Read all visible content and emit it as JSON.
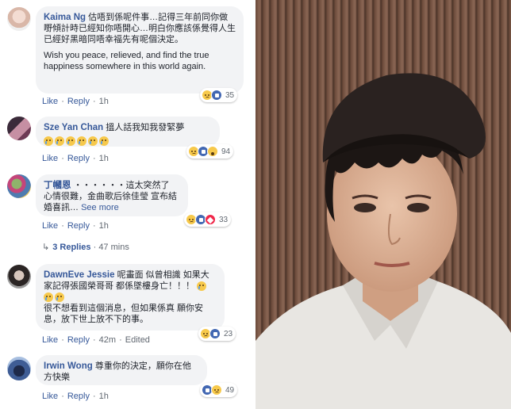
{
  "comments": [
    {
      "author": "Kaima Ng",
      "text": "估唔到係呢件事…記得三年前同你做嘢傾計時已經知你唔開心…明白你應該係覺得人生已經好黑暗同唔幸福先有呢個決定。",
      "text_en": "Wish you peace, relieved, and find the true happiness somewhere in this world again.",
      "reaction_count": "35",
      "like": "Like",
      "reply": "Reply",
      "time": "1h"
    },
    {
      "author": "Sze Yan Chan",
      "text": "搵人話我知我發緊夢",
      "reaction_count": "94",
      "like": "Like",
      "reply": "Reply",
      "time": "1h"
    },
    {
      "author": "丁幗恩",
      "text": "・・・・・・這太突然了 心情很難，金曲歌后徐佳瑩 宣布結婚喜訊…",
      "see_more": "See more",
      "reaction_count": "33",
      "like": "Like",
      "reply": "Reply",
      "time": "1h",
      "replies_label": "3 Replies",
      "replies_time": "47 mins"
    },
    {
      "author": "DawnEve Jessie",
      "text": "呢畫面 似曾相識 如果大家記得張國榮哥哥 都係墜樓身亡！！！",
      "text2": "很不想看到這個消息，但如果係真 願你安息，放下世上放不下的事。",
      "reaction_count": "23",
      "like": "Like",
      "reply": "Reply",
      "time": "42m",
      "edited": "Edited"
    },
    {
      "author": "Irwin Wong",
      "text": "尊重你的決定，願你在他方快樂",
      "reaction_count": "49",
      "like": "Like",
      "reply": "Reply",
      "time": "1h"
    }
  ],
  "colors": {
    "link": "#365899",
    "bubble": "#f2f3f5",
    "meta": "#606770"
  }
}
